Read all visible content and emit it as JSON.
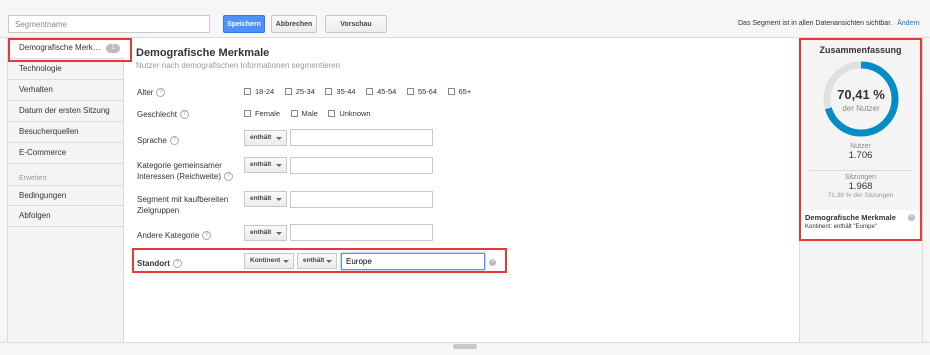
{
  "toolbar": {
    "segment_placeholder": "Segmentname",
    "save_label": "Speichern",
    "cancel_label": "Abbrechen",
    "preview_label": "Vorschau",
    "visibility_text": "Das Segment ist in allen Datenansichten sichtbar.",
    "change_link": "Ändern"
  },
  "sidebar": {
    "items": [
      {
        "label": "Demografische Merk…",
        "badge": "1"
      },
      {
        "label": "Technologie"
      },
      {
        "label": "Verhalten"
      },
      {
        "label": "Datum der ersten Sitzung"
      },
      {
        "label": "Besucherquellen"
      },
      {
        "label": "E-Commerce"
      }
    ],
    "advanced_heading": "Erweitert",
    "advanced_items": [
      {
        "label": "Bedingungen"
      },
      {
        "label": "Abfolgen"
      }
    ]
  },
  "main": {
    "title": "Demografische Merkmale",
    "subtitle": "Nutzer nach demografischen Informationen segmentieren",
    "age": {
      "label": "Alter",
      "options": [
        "18-24",
        "25-34",
        "35-44",
        "45-54",
        "55-64",
        "65+"
      ]
    },
    "gender": {
      "label": "Geschlecht",
      "options": [
        "Female",
        "Male",
        "Unknown"
      ]
    },
    "language": {
      "label": "Sprache",
      "operator": "enthält",
      "value": ""
    },
    "interest": {
      "label_line1": "Kategorie gemeinsamer",
      "label_line2": "Interessen (Reichweite)",
      "operator": "enthält",
      "value": ""
    },
    "market": {
      "label_line1": "Segment mit kaufbereiten",
      "label_line2": "Zielgruppen",
      "operator": "enthält",
      "value": ""
    },
    "other": {
      "label": "Andere Kategorie",
      "operator": "enthält",
      "value": ""
    },
    "location": {
      "label": "Standort",
      "dimension": "Kontinent",
      "operator": "enthält",
      "value": "Europe"
    },
    "help_glyph": "?"
  },
  "summary": {
    "title": "Zusammenfassung",
    "percent": "70,41 %",
    "percent_fraction": 0.7041,
    "percent_caption": "der Nutzer",
    "users_label": "Nutzer",
    "users_value": "1.706",
    "sessions_label": "Sitzungen",
    "sessions_value": "1.968",
    "sessions_sub": "71,38 % der Sitzungen",
    "card_title": "Demografische Merkmale",
    "card_text": "Kontinent: enthält \"Europe\""
  },
  "colors": {
    "accent": "#4d90fe",
    "gauge": "#058dc7",
    "gauge_track": "#e0e0e0",
    "highlight": "#e53935"
  }
}
